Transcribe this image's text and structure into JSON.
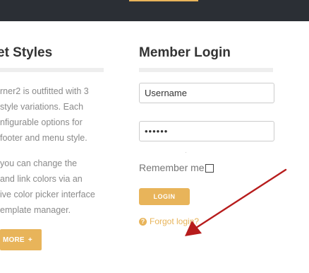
{
  "top_bar": {
    "accent_color": "#e8b45a",
    "background": "#2b2f35"
  },
  "left_column": {
    "heading": "et Styles",
    "lines": [
      "rner2 is outfitted with 3",
      "style variations. Each",
      "nfigurable options for",
      "footer and menu style.",
      " you can change the",
      "and link colors via an",
      "ive color picker interface",
      "emplate manager."
    ],
    "more_button": {
      "label": "MORE",
      "plus_glyph": "+"
    }
  },
  "member_login": {
    "heading": "Member Login",
    "username": {
      "value": "Username",
      "placeholder": "Username"
    },
    "password": {
      "value": "••••••"
    },
    "remember_label": "Remember me",
    "login_button": "LOGIN",
    "forgot_link": "Forgot login?",
    "forgot_icon": "question-circle-icon"
  },
  "colors": {
    "accent": "#e8b45a",
    "arrow": "#b71c1c"
  }
}
